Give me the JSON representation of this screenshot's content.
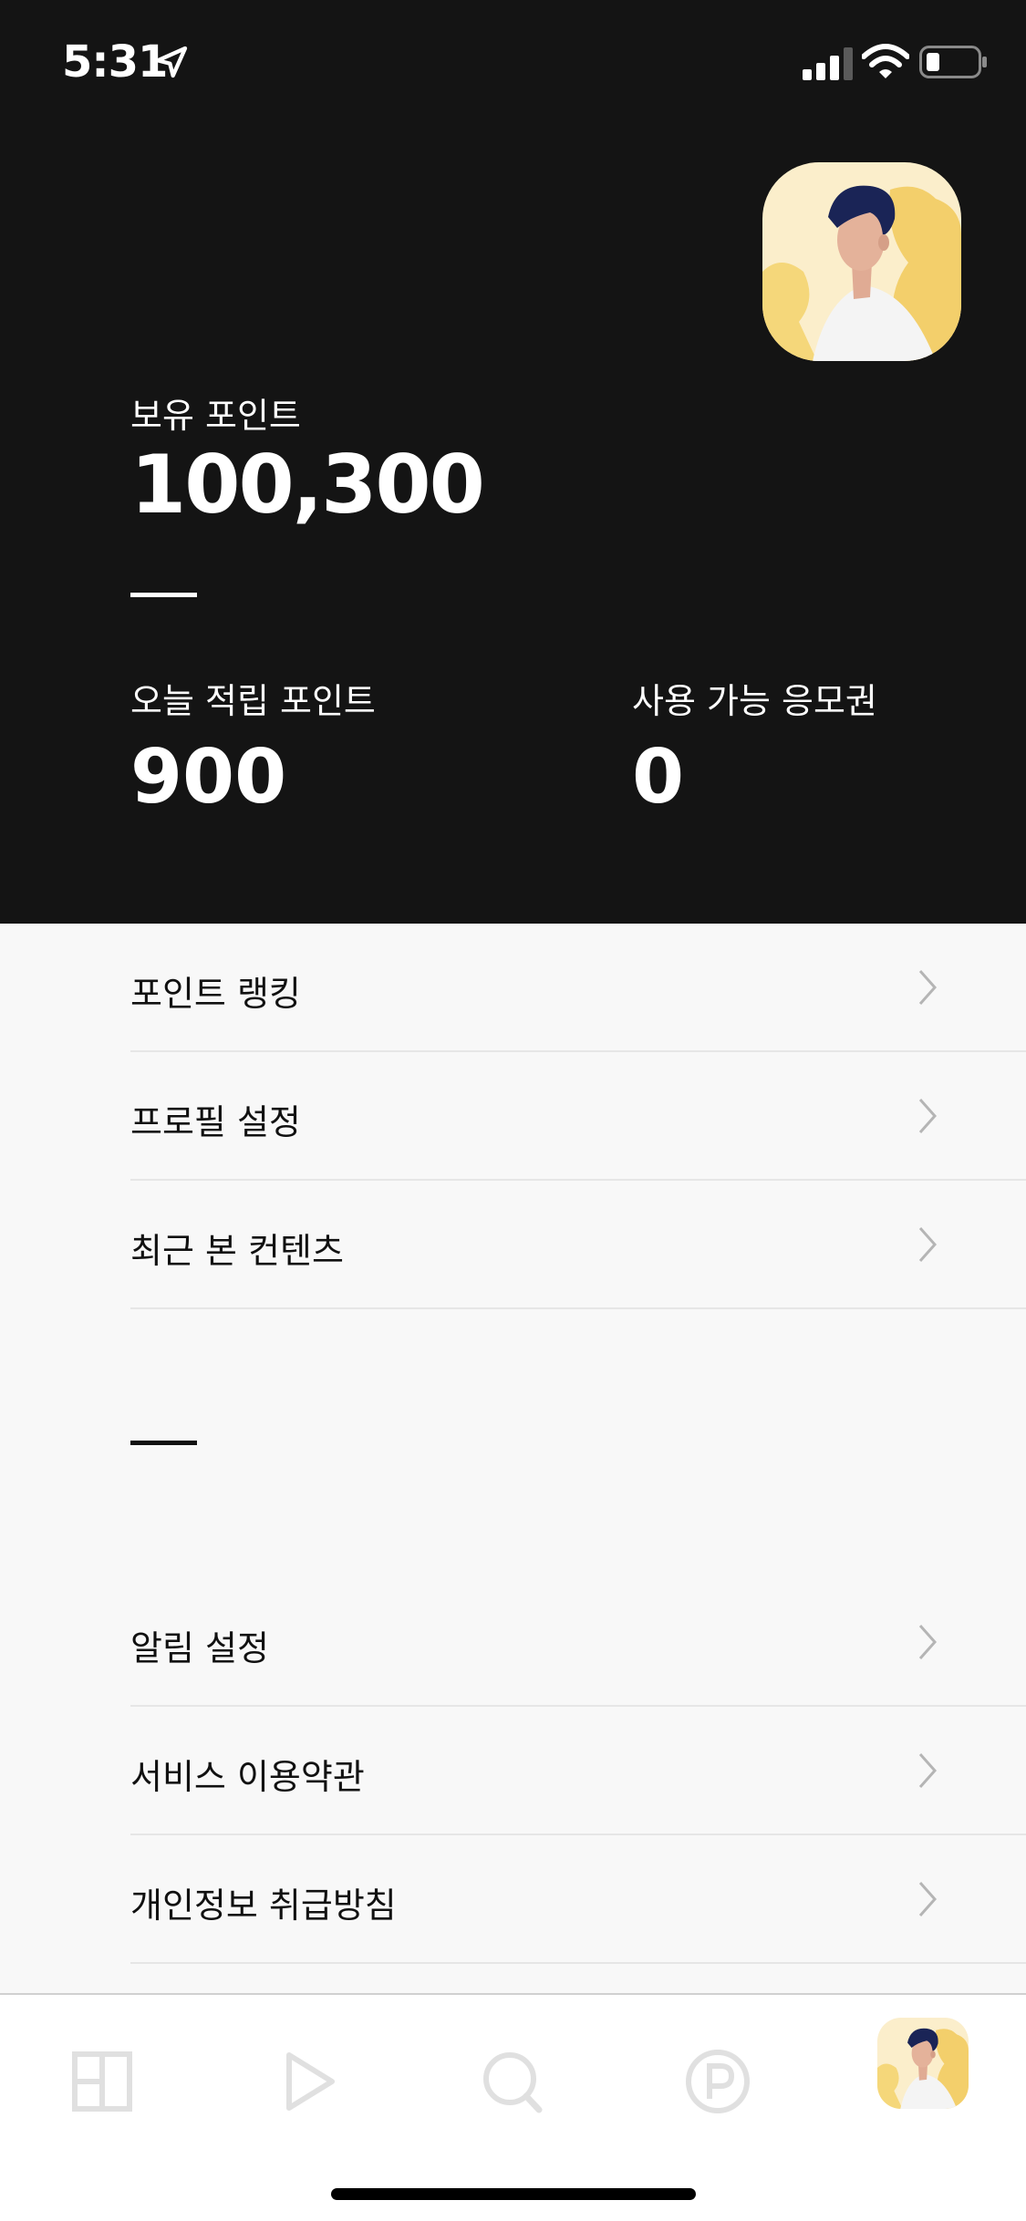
{
  "status_bar": {
    "time": "5:31",
    "icons": [
      "location-arrow-icon",
      "cellular-signal-icon",
      "wifi-icon",
      "battery-icon"
    ]
  },
  "profile": {
    "avatar": "avatar-illustration-man"
  },
  "points": {
    "label": "보유 포인트",
    "value": "100,300"
  },
  "stats": {
    "today": {
      "label": "오늘 적립 포인트",
      "value": "900"
    },
    "tickets": {
      "label": "사용 가능 응모권",
      "value": "0"
    }
  },
  "menu": {
    "section1": [
      {
        "label": "포인트 랭킹"
      },
      {
        "label": "프로필 설정"
      },
      {
        "label": "최근 본 컨텐츠"
      }
    ],
    "section2": [
      {
        "label": "알림 설정"
      },
      {
        "label": "서비스 이용약관"
      },
      {
        "label": "개인정보 취급방침"
      }
    ]
  },
  "tab_bar": {
    "tabs": [
      "home-grid-icon",
      "play-icon",
      "search-icon",
      "points-p-icon",
      "profile-avatar"
    ]
  },
  "colors": {
    "header_bg": "#141414",
    "body_bg": "#f8f8f8",
    "tab_icon": "#e0e0e0",
    "avatar_yellow": "#f3cf6b"
  }
}
